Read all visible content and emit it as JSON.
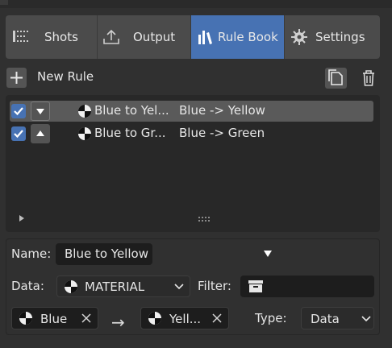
{
  "tabs": [
    {
      "label": "Shots",
      "icon": "sequence-strip-icon",
      "active": false
    },
    {
      "label": "Output",
      "icon": "export-icon",
      "active": false
    },
    {
      "label": "Rule Book",
      "icon": "books-icon",
      "active": true
    },
    {
      "label": "Settings",
      "icon": "gear-icon",
      "active": false
    }
  ],
  "toolbar": {
    "new_rule_label": "New Rule"
  },
  "rules": [
    {
      "checked": true,
      "arrow": "down",
      "name": "Blue to Yel...",
      "description": "Blue -> Yellow",
      "selected": true
    },
    {
      "checked": true,
      "arrow": "up",
      "name": "Blue to Gr...",
      "description": "Blue -> Green",
      "selected": false
    }
  ],
  "detail": {
    "name_label": "Name:",
    "name_value": "Blue to Yellow",
    "data_label": "Data:",
    "data_value": "MATERIAL",
    "filter_label": "Filter:",
    "from_value": "Blue",
    "arrow_symbol": "→",
    "to_value": "Yell...",
    "type_label": "Type:",
    "type_value": "Data"
  },
  "colors": {
    "accent": "#4772b3",
    "background": "#303030",
    "list_bg": "#282828",
    "field_bg": "#1d1d1d"
  }
}
